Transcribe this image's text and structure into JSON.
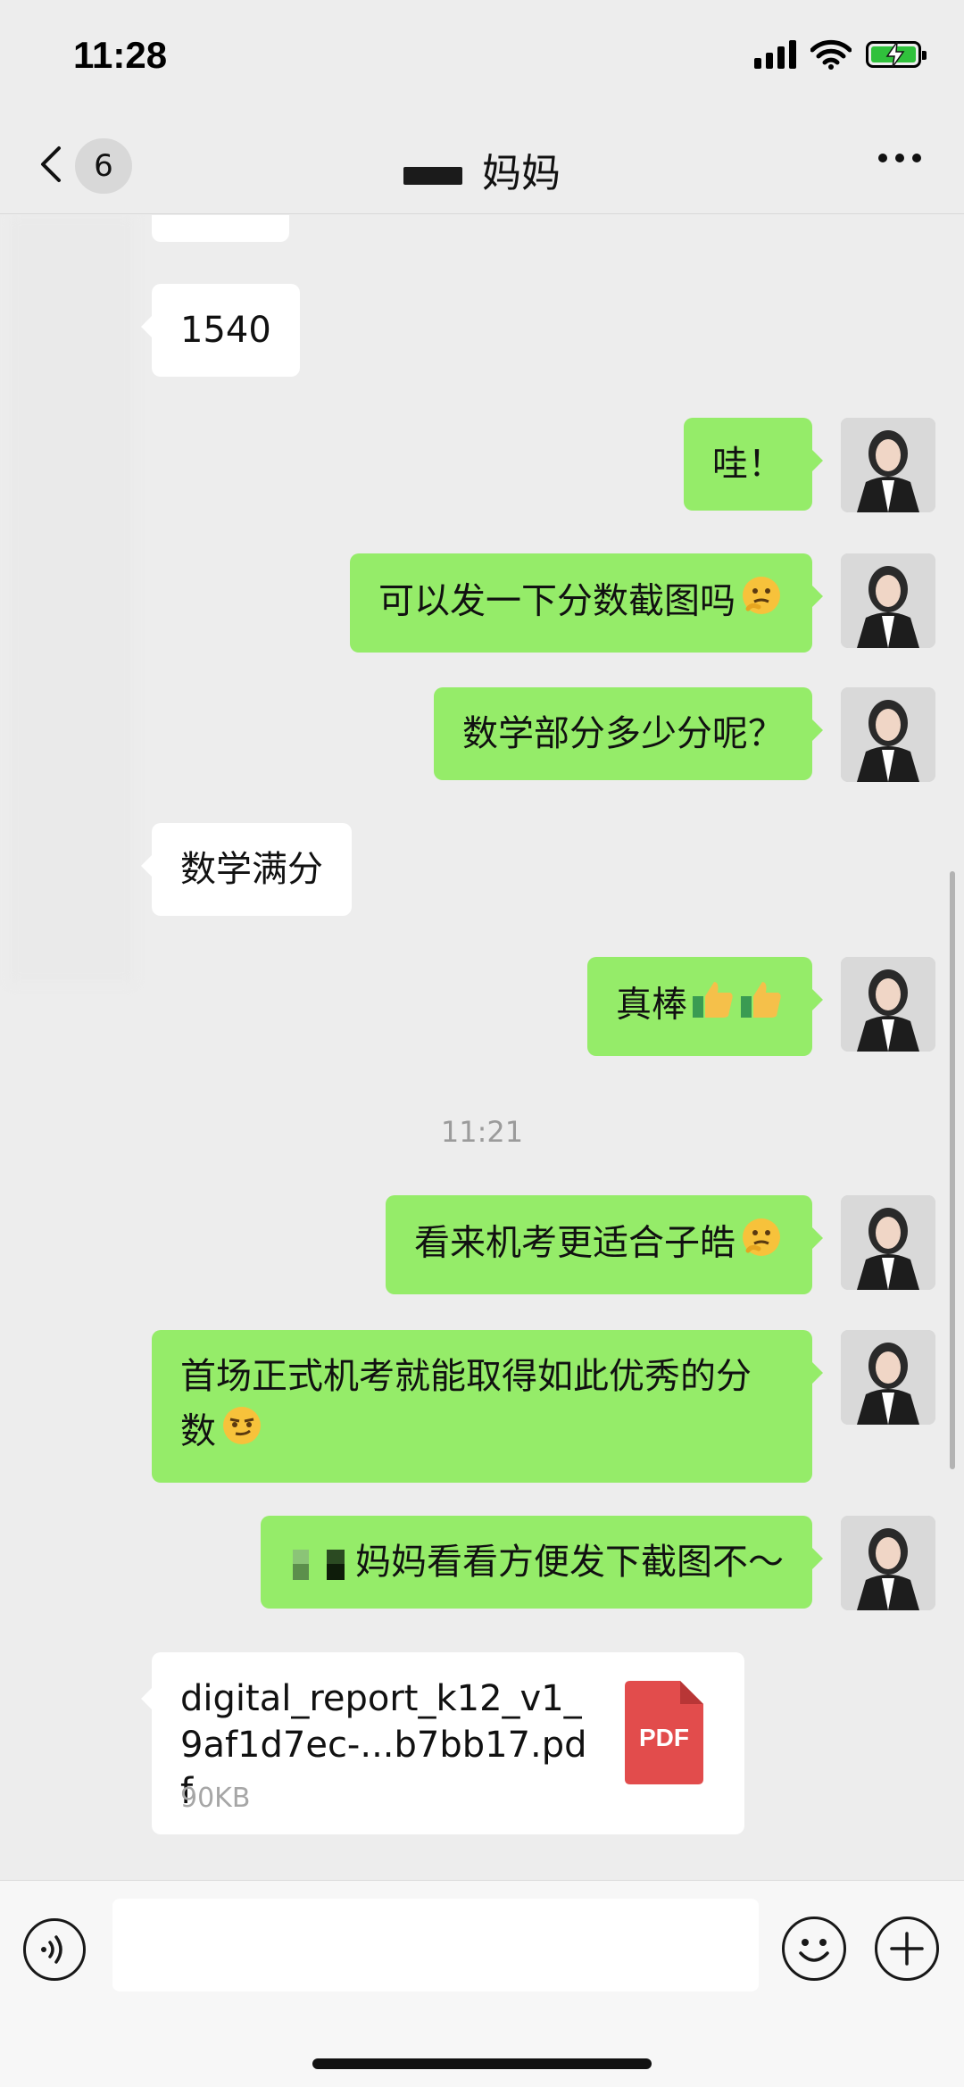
{
  "status_bar": {
    "time": "11:28"
  },
  "nav": {
    "unread_count": "6",
    "title": "妈妈"
  },
  "messages": [
    {
      "sender": "contact",
      "text": "1540"
    },
    {
      "sender": "me",
      "text": "哇！"
    },
    {
      "sender": "me",
      "text": "可以发一下分数截图吗",
      "emoji": "thinking-face-emoji"
    },
    {
      "sender": "me",
      "text": "数学部分多少分呢？"
    },
    {
      "sender": "contact",
      "text": "数学满分"
    },
    {
      "sender": "me",
      "text": "真棒",
      "emoji": "thumbs-up-emoji ×2"
    },
    {
      "sender": "me",
      "text": "看来机考更适合子皓",
      "emoji": "thinking-face-emoji"
    },
    {
      "sender": "me",
      "text": "首场正式机考就能取得如此优秀的分数",
      "emoji": "smirk-face-emoji"
    },
    {
      "sender": "me",
      "text": "妈妈看看方便发下截图不～"
    }
  ],
  "timestamp": "11:21",
  "file": {
    "name": "digital_report_k12_v1_9af1d7ec-...b7bb17.pdf",
    "size": "90KB",
    "type_label": "PDF"
  },
  "colors": {
    "outgoing_bubble": "#95ec69",
    "incoming_bubble": "#ffffff",
    "background": "#ededed",
    "pdf_icon": "#e24c4c"
  }
}
